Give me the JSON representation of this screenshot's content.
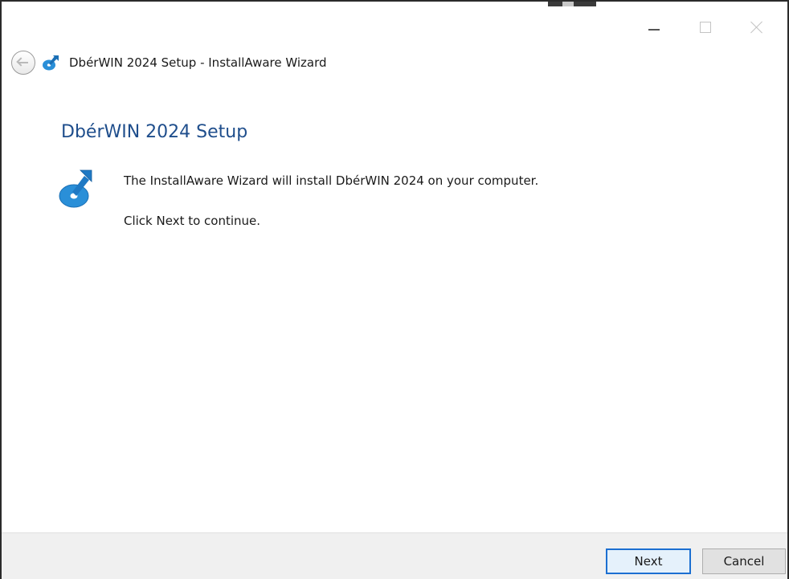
{
  "window": {
    "title": "DbérWIN 2024 Setup - InstallAware Wizard"
  },
  "page": {
    "heading": "DbérWIN 2024 Setup",
    "line1": "The InstallAware Wizard will install DbérWIN 2024 on your computer.",
    "line2": "Click Next to continue."
  },
  "buttons": {
    "next": "Next",
    "cancel": "Cancel"
  },
  "icons": {
    "back": "back-arrow-icon",
    "app": "installaware-disc-icon",
    "minimize": "minimize-icon",
    "maximize": "maximize-icon",
    "close": "close-icon"
  },
  "colors": {
    "heading": "#1f4e8c",
    "accent": "#1c6fd1",
    "footer": "#f0f0f0"
  }
}
